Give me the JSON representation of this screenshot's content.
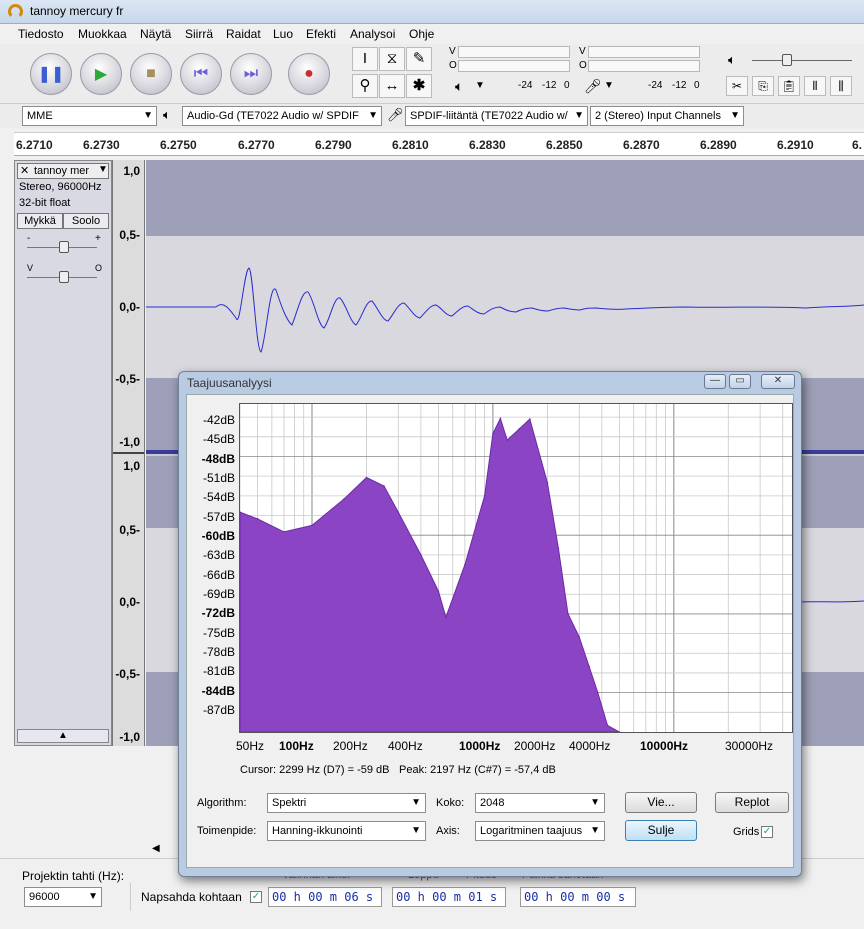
{
  "window": {
    "title": "tannoy mercury fr"
  },
  "menu": [
    "Tiedosto",
    "Muokkaa",
    "Näytä",
    "Siirrä",
    "Raidat",
    "Luo",
    "Efekti",
    "Analysoi",
    "Ohje"
  ],
  "meters": {
    "play": {
      "top": "V",
      "bottom": "O",
      "scale": [
        "-24",
        "-12",
        "0"
      ]
    },
    "record": {
      "top": "V",
      "bottom": "O",
      "scale": [
        "-24",
        "-12",
        "0"
      ]
    }
  },
  "device": {
    "host": "MME",
    "output": "Audio-Gd (TE7022 Audio w/ SPDIF",
    "input": "SPDIF-liitäntä (TE7022 Audio w/",
    "channels": "2 (Stereo) Input Channels"
  },
  "ruler": [
    "6.2710",
    "6.2730",
    "6.2750",
    "6.2770",
    "6.2790",
    "6.2810",
    "6.2830",
    "6.2850",
    "6.2870",
    "6.2890",
    "6.2910",
    "6."
  ],
  "track": {
    "name": "tannoy mer",
    "format": "Stereo, 96000Hz",
    "bits": "32-bit float",
    "mute": "Mykkä",
    "solo": "Soolo",
    "gain_minus": "-",
    "gain_plus": "+",
    "pan_left": "V",
    "pan_right": "O"
  },
  "vruler": {
    "top": [
      "1,0",
      "0,5-",
      "0,0-",
      "-0,5-",
      "-1,0"
    ],
    "bottom": [
      "1,0",
      "0,5-",
      "0,0-",
      "-0,5-",
      "-1,0"
    ]
  },
  "dialog": {
    "title": "Taajuusanalyysi",
    "y_labels": [
      "-42dB",
      "-45dB",
      "-48dB",
      "-51dB",
      "-54dB",
      "-57dB",
      "-60dB",
      "-63dB",
      "-66dB",
      "-69dB",
      "-72dB",
      "-75dB",
      "-78dB",
      "-81dB",
      "-84dB",
      "-87dB"
    ],
    "x_labels": [
      "50Hz",
      "100Hz",
      "200Hz",
      "400Hz",
      "1000Hz",
      "2000Hz",
      "4000Hz",
      "10000Hz",
      "30000Hz"
    ],
    "cursor": "Cursor: 2299 Hz (D7) = -59 dB",
    "peak": "Peak: 2197 Hz (C#7) = -57,4 dB",
    "algorithm_label": "Algorithm:",
    "algorithm": "Spektri",
    "size_label": "Koko:",
    "size": "2048",
    "export": "Vie...",
    "replot": "Replot",
    "function_label": "Toimenpide:",
    "function": "Hanning-ikkunointi",
    "axis_label": "Axis:",
    "axis": "Logaritminen taajuus",
    "close": "Sulje",
    "grids": "Grids"
  },
  "chart_data": {
    "type": "area",
    "title": "",
    "xlabel": "",
    "ylabel": "",
    "xscale": "log",
    "xlim": [
      40,
      45000
    ],
    "ylim": [
      -90,
      -40
    ],
    "x": [
      40,
      50,
      70,
      100,
      150,
      200,
      250,
      300,
      400,
      500,
      550,
      700,
      900,
      1000,
      1100,
      1200,
      1400,
      1600,
      2000,
      2300,
      2600,
      3000,
      3400,
      3800,
      4300,
      5000
    ],
    "series": [
      {
        "values": [
          -56.5,
          -57.5,
          -59.5,
          -58.5,
          -54.5,
          -51.2,
          -52.5,
          -56.5,
          -63,
          -68.5,
          -72.5,
          -64.5,
          -54,
          -44.5,
          -42.2,
          -45.5,
          -43.8,
          -42.3,
          -52,
          -62,
          -72,
          -75.5,
          -80,
          -84,
          -89,
          -90
        ]
      }
    ],
    "grid": true
  },
  "project": {
    "rate_label": "Projektin tahti (Hz):",
    "rate": "96000",
    "snap_label": "Napsahda kohtaan",
    "start": "00 h 00 m 06 s",
    "end": "00 h 00 m 01 s",
    "third": "00 h 00 m 00 s",
    "cut_labels": [
      "Valinnan alku:",
      "Loppu",
      "Pituus",
      "Paikka sanotaan"
    ]
  }
}
